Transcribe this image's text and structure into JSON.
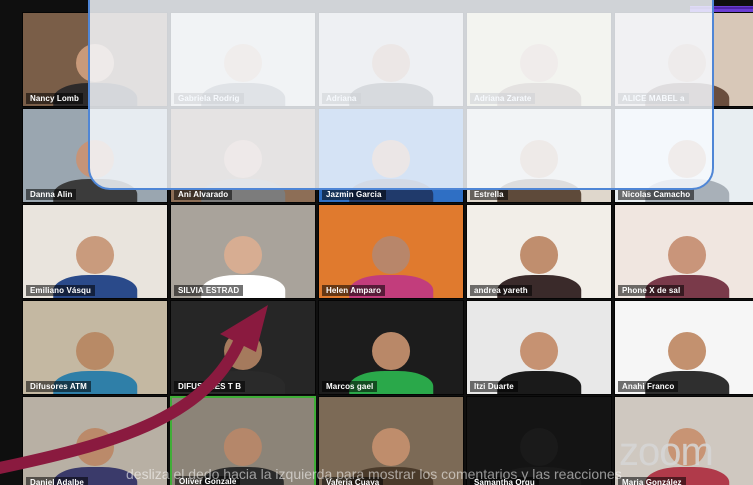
{
  "app": {
    "logo_text": "zoom"
  },
  "caption": "desliza el dedo hacia la izquierda para mostrar los comentarios y las reacciones",
  "colors": {
    "overlay_border": "#4f86d6",
    "active_speaker": "#3fae37",
    "arrow": "#8a1a3f"
  },
  "participants": [
    {
      "name": "Nancy Lomb",
      "bg": "#7a5e48",
      "skin": "#c99a7a",
      "shirt": "#2d2a2a"
    },
    {
      "name": "Gabriela Rodrig",
      "bg": "#d9d3c6",
      "skin": "#d2ab8f",
      "shirt": "#6e6e6e"
    },
    {
      "name": "Adriana",
      "bg": "#c7c2b8",
      "skin": "#b88a6a",
      "shirt": "#3a3a3a"
    },
    {
      "name": "Adriana Zarate",
      "bg": "#e4d6a8",
      "skin": "#d4a98a",
      "shirt": "#8a6a4a"
    },
    {
      "name": "ALICE MABEL a",
      "bg": "#d8c8b8",
      "skin": "#c9a188",
      "shirt": "#6a4e3e"
    },
    {
      "name": "Danna Alin",
      "bg": "#9aa6b0",
      "skin": "#c69478",
      "shirt": "#3b3b3b"
    },
    {
      "name": "Ani Alvarado",
      "bg": "#8d6e56",
      "skin": "#c8957a",
      "shirt": "#7c7c7c"
    },
    {
      "name": "Jazmin Garcia",
      "bg": "#2f6fc4",
      "skin": "#b48668",
      "shirt": "#203a6b"
    },
    {
      "name": "Estrella",
      "bg": "#dfd7cc",
      "skin": "#c89979",
      "shirt": "#5e4a3a"
    },
    {
      "name": "Nicolas Camacho",
      "bg": "#e8eef2",
      "skin": "#d3a887",
      "shirt": "#a8b0b8"
    },
    {
      "name": "Emiliano Vásqu",
      "bg": "#e9e4dd",
      "skin": "#c99b7d",
      "shirt": "#2a4a8a"
    },
    {
      "name": "SILVIA ESTRAD",
      "bg": "#a9a39b",
      "skin": "#d7ad92",
      "shirt": "#ffffff"
    },
    {
      "name": "Helen Amparo",
      "bg": "#e07a2e",
      "skin": "#b8866a",
      "shirt": "#c23d7c"
    },
    {
      "name": "andrea yareth",
      "bg": "#f2eee8",
      "skin": "#c08e6e",
      "shirt": "#3a2a2a"
    },
    {
      "name": "Phone X de sal",
      "bg": "#f0e6e0",
      "skin": "#c9957a",
      "shirt": "#7a3a4a"
    },
    {
      "name": "Difusores ATM",
      "bg": "#c4b8a2",
      "skin": "#b88a66",
      "shirt": "#2f7fa8"
    },
    {
      "name": "DIFUSORES T B",
      "bg": "#262626",
      "skin": "#a57a5d",
      "shirt": "#2a2a2a"
    },
    {
      "name": "Marcos gael",
      "bg": "#1c1c1c",
      "skin": "#b98868",
      "shirt": "#2aa84a"
    },
    {
      "name": "Itzi Duarte",
      "bg": "#e8e8e8",
      "skin": "#c69272",
      "shirt": "#1a1a1a"
    },
    {
      "name": "Anahi Franco",
      "bg": "#f6f6f6",
      "skin": "#c3916f",
      "shirt": "#2f2f2f"
    },
    {
      "name": "Daniel Adalbe",
      "bg": "#b8b0a4",
      "skin": "#bb8a6a",
      "shirt": "#3a3a6a"
    },
    {
      "name": "Oliver Gonzale",
      "bg": "#8c8478",
      "skin": "#b5876a",
      "shirt": "#2a2a2a"
    },
    {
      "name": "Valeria Cuaya",
      "bg": "#7c6a56",
      "skin": "#bf8d6c",
      "shirt": "#4a3a2a"
    },
    {
      "name": "Samantha Orqu",
      "bg": "#141414",
      "skin": "#1a1a1a",
      "shirt": "#1a1a1a"
    },
    {
      "name": "Maria González",
      "bg": "#cfc8c0",
      "skin": "#c89474",
      "shirt": "#b03a4a"
    }
  ]
}
